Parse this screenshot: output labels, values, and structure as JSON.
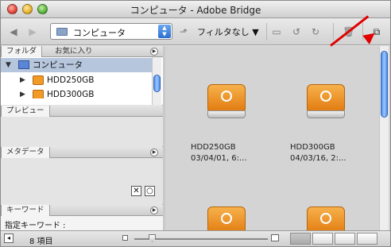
{
  "window": {
    "title": "コンピュータ - Adobe Bridge"
  },
  "toolbar": {
    "path_label": "コンピュータ",
    "filter_label": "フィルタなし"
  },
  "panels": {
    "folders": {
      "tabs": [
        "フォルダ",
        "お気に入り"
      ],
      "tree": [
        {
          "label": "コンピュータ",
          "expanded": true,
          "selected": true
        },
        {
          "label": "HDD250GB"
        },
        {
          "label": "HDD300GB"
        }
      ]
    },
    "preview": {
      "title": "プレビュー"
    },
    "metadata": {
      "title": "メタデータ"
    },
    "keywords": {
      "title": "キーワード",
      "assigned_label": "指定キーワード :"
    }
  },
  "content": {
    "items": [
      {
        "name": "HDD250GB",
        "date": "03/04/01, 6:..."
      },
      {
        "name": "HDD300GB",
        "date": "04/03/16, 2:..."
      },
      {
        "name": "",
        "date": ""
      },
      {
        "name": "",
        "date": ""
      }
    ]
  },
  "status": {
    "count_label": "8 項目"
  },
  "colors": {
    "accent": "#2b6fcf",
    "annotation_arrow": "#e10000",
    "drive": "#f29a26"
  }
}
